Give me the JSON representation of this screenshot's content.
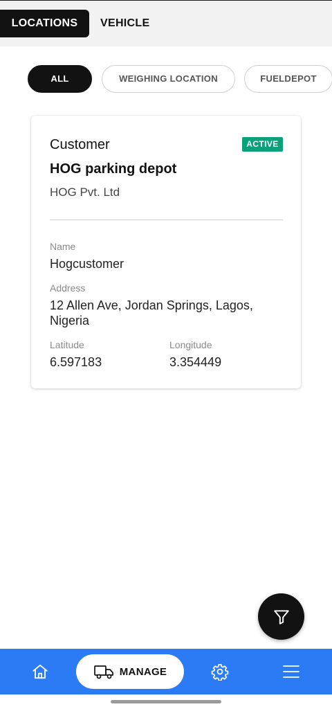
{
  "tabs": {
    "locations": "LOCATIONS",
    "vehicle": "VEHICLE"
  },
  "filters": {
    "all": "ALL",
    "weighing": "WEIGHING LOCATION",
    "fueldepot": "FUELDEPOT"
  },
  "card": {
    "type": "Customer",
    "status": "ACTIVE",
    "title": "HOG parking depot",
    "company": "HOG Pvt. Ltd",
    "name_label": "Name",
    "name_value": "Hogcustomer",
    "address_label": "Address",
    "address_value": "12 Allen Ave, Jordan Springs, Lagos, Nigeria",
    "latitude_label": "Latitude",
    "latitude_value": "6.597183",
    "longitude_label": "Longitude",
    "longitude_value": "3.354449"
  },
  "fab": {
    "icon": "filter-icon"
  },
  "bottom_nav": {
    "home_icon": "home-icon",
    "manage_icon": "truck-icon",
    "manage_label": "MANAGE",
    "settings_icon": "gear-icon",
    "menu_icon": "hamburger-menu-icon"
  },
  "colors": {
    "accent": "#2b7bf5",
    "active_badge": "#0aa07a",
    "dark": "#121212"
  }
}
